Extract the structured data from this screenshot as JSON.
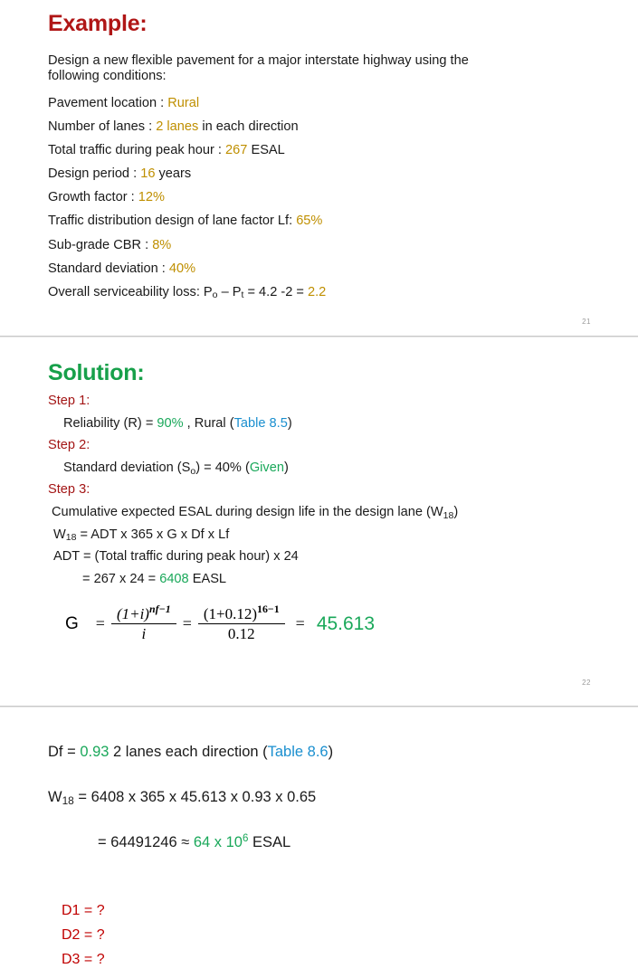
{
  "slide1": {
    "page_number": "21",
    "title": "Example:",
    "title_color": "#b01616",
    "intro_line1": "Design a new flexible pavement for a major interstate highway using the",
    "intro_line2": "following conditions:",
    "items": [
      {
        "label": "Pavement location : ",
        "value": "Rural",
        "tail": ""
      },
      {
        "label": "Number of lanes    : ",
        "value": "2 lanes",
        "tail": " in each direction"
      },
      {
        "label": "Total traffic during peak hour : ",
        "value": "267",
        "tail": " ESAL"
      },
      {
        "label": "Design period : ",
        "value": "16",
        "tail": " years"
      },
      {
        "label": "Growth factor : ",
        "value": "12%",
        "tail": ""
      },
      {
        "label": "Traffic distribution design of lane factor Lf: ",
        "value": "65%",
        "tail": ""
      },
      {
        "label": "Sub-grade CBR  : ",
        "value": "8%",
        "tail": ""
      },
      {
        "label": "Standard deviation : ",
        "value": "40%",
        "tail": ""
      }
    ],
    "serviceability": {
      "prefix": "Overall serviceability loss: P",
      "sub_o": "o",
      "mid": " – P",
      "sub_t": "t",
      "expr": " = 4.2 -2 = ",
      "value": "2.2"
    }
  },
  "slide2": {
    "page_number": "22",
    "title": "Solution:",
    "title_color": "#17a04a",
    "step1_label": "Step 1:",
    "step1_text_a": "Reliability (R) = ",
    "step1_value": "90%",
    "step1_text_b": " , Rural   (",
    "step1_ref": "Table 8.5",
    "step1_text_c": ")",
    "step2_label": "Step 2:",
    "step2_text_a": "Standard deviation (S",
    "step2_sub": "o",
    "step2_text_b": ") = 40%  (",
    "step2_ref": "Given",
    "step2_text_c": ")",
    "step3_label": "Step 3:",
    "step3_line1_a": "Cumulative expected ESAL during design life in the design lane (W",
    "step3_line1_sub": "18",
    "step3_line1_b": ")",
    "step3_line2_a": "W",
    "step3_line2_sub": "18",
    "step3_line2_b": " = ADT x 365 x G x Df x Lf",
    "step3_line3": "ADT = (Total traffic during peak hour) x 24",
    "step3_line4_a": "=  267 x 24 = ",
    "step3_line4_value": "6408",
    "step3_line4_b": " EASL",
    "formula": {
      "symbol": "G",
      "equals1": "=",
      "frac1_num_base": "(1+i)",
      "frac1_num_exp": "nf−1",
      "frac1_den": "i",
      "equals2": "=",
      "frac2_num_base": "(1+0.12)",
      "frac2_num_exp": "16−1",
      "frac2_den": "0.12",
      "equals3": "=",
      "result": "45.613"
    }
  },
  "slide3": {
    "df_line_a": "Df = ",
    "df_value": "0.93",
    "df_line_b": "  2 lanes each direction (",
    "df_ref": "Table 8.6",
    "df_line_c": ")",
    "w18_line_a": "W",
    "w18_sub": "18",
    "w18_line_b": " = 6408 x 365 x 45.613 x 0.93 x 0.65",
    "result_a": "= 64491246 ≈  ",
    "result_value": "64 x 10",
    "result_exp": "6",
    "result_b": "  ESAL",
    "unknowns": [
      "D1 = ?",
      "D2 = ?",
      "D3 = ?"
    ]
  },
  "colors": {
    "gold": "#bf8f00",
    "green": "#1aa85a",
    "blue": "#1a8fcf",
    "red": "#c00000",
    "dark_red": "#a31515",
    "title_red": "#b01616",
    "title_green": "#17a04a",
    "separator": "#c8c8c8"
  }
}
